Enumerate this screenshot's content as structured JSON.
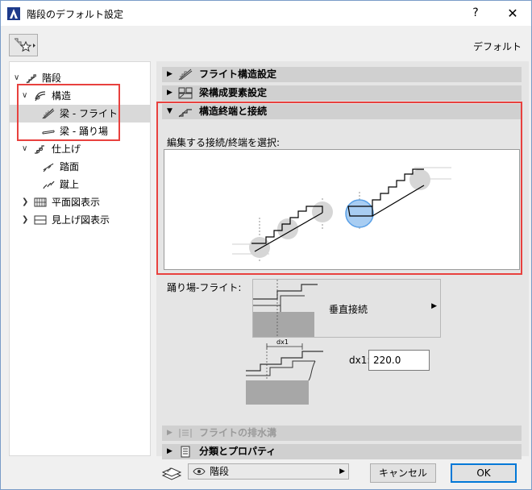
{
  "window": {
    "title": "階段のデフォルト設定",
    "help_label": "?",
    "close_label": "✕"
  },
  "header": {
    "favorites_icon": "favorites-star-icon",
    "default_label": "デフォルト"
  },
  "tree": {
    "items": [
      {
        "label": "階段",
        "icon": "stair-icon",
        "expanded": true
      },
      {
        "label": "構造",
        "icon": "structure-icon",
        "expanded": true
      },
      {
        "label": "梁 - フライト",
        "icon": "flight-beam-icon",
        "selected": true
      },
      {
        "label": "梁 - 踊り場",
        "icon": "landing-beam-icon"
      },
      {
        "label": "仕上げ",
        "icon": "finish-icon",
        "expanded": true
      },
      {
        "label": "踏面",
        "icon": "tread-icon"
      },
      {
        "label": "蹴上",
        "icon": "riser-icon"
      },
      {
        "label": "平面図表示",
        "icon": "floor-plan-icon",
        "expanded": false
      },
      {
        "label": "見上げ図表示",
        "icon": "ceiling-plan-icon",
        "expanded": false
      }
    ]
  },
  "sections": {
    "flight_structure": "フライト構造設定",
    "beam_components": "梁構成要素設定",
    "structure_end": "構造終端と接続",
    "flight_drainage": "フライトの排水溝",
    "classification": "分類とプロパティ"
  },
  "structure_end": {
    "instruction": "編集する接続/終端を選択:",
    "connection_label": "踊り場-フライト:",
    "connection_value": "垂直接続",
    "dx_label": "dx1:",
    "dx_value": "220.0",
    "dx_diagram_label": "dx1"
  },
  "footer": {
    "layer_label": "階段",
    "cancel_label": "キャンセル",
    "ok_label": "OK"
  },
  "colors": {
    "highlight_red": "#e8413e",
    "selection_blue": "#0078d7",
    "selected_node": "#5aa0e6"
  }
}
